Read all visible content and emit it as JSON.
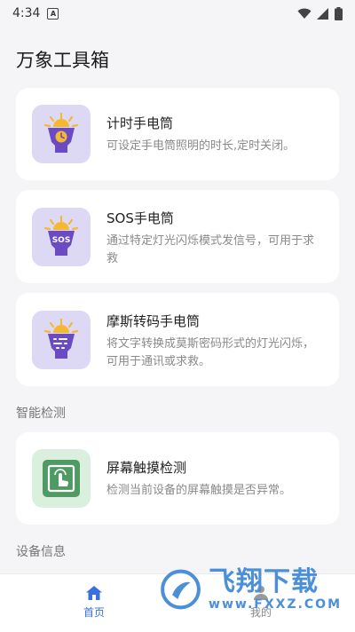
{
  "status_bar": {
    "time": "4:34",
    "notification_glyph": "A"
  },
  "app_title": "万象工具箱",
  "cards": [
    {
      "title": "计时手电筒",
      "desc": "可设定手电筒照明的时长,定时关闭。",
      "icon": "flashlight-timer-icon",
      "icon_badge": ""
    },
    {
      "title": "SOS手电筒",
      "desc": "通过特定灯光闪烁模式发信号，可用于求救",
      "icon": "flashlight-sos-icon",
      "icon_badge": "SOS"
    },
    {
      "title": "摩斯转码手电筒",
      "desc": "将文字转换成莫斯密码形式的灯光闪烁，可用于通讯或求救。",
      "icon": "flashlight-morse-icon",
      "icon_badge": ""
    },
    {
      "title": "屏幕触摸检测",
      "desc": "检测当前设备的屏幕触摸是否异常。",
      "icon": "touch-screen-icon",
      "icon_badge": ""
    }
  ],
  "sections": {
    "smart_detect": "智能检测",
    "device_info": "设备信息"
  },
  "bottom_nav": {
    "home": "首页",
    "mine": "我的"
  },
  "watermark": {
    "text_cn": "飞翔下载",
    "url": "www.FXXZ.COM"
  },
  "colors": {
    "accent": "#3a6fe0",
    "icon_purple": "#6b4bc4",
    "icon_tile_purple": "#ddd9f5",
    "icon_tile_green": "#dbefdf",
    "icon_green": "#4f9a62",
    "bulb_yellow": "#f5b82e"
  }
}
